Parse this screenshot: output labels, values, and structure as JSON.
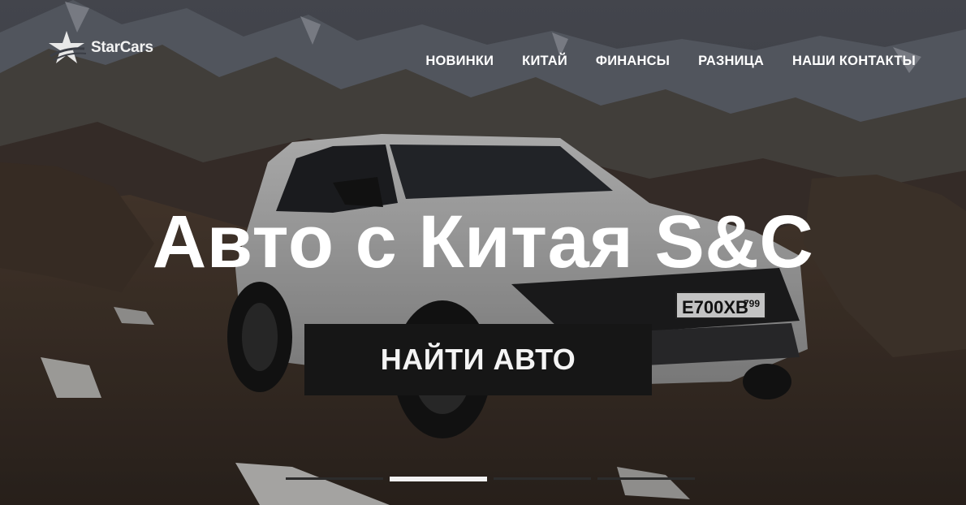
{
  "brand": {
    "name": "StarCars"
  },
  "nav": {
    "items": [
      {
        "label": "НОВИНКИ"
      },
      {
        "label": "КИТАЙ"
      },
      {
        "label": "ФИНАНСЫ"
      },
      {
        "label": "РАЗНИЦА"
      },
      {
        "label": "НАШИ КОНТАКТЫ"
      }
    ]
  },
  "hero": {
    "title": "Авто с Китая S&C",
    "cta_label": "НАЙТИ АВТО",
    "plate": {
      "main": "E700XB",
      "region": "799"
    },
    "slider": {
      "count": 4,
      "active_index": 1
    }
  },
  "colors": {
    "overlay": "#1e1f24",
    "cta_bg": "#161616",
    "text": "#ffffff",
    "active_dot": "#f2f2f2",
    "inactive_dot": "#2c2c2c"
  }
}
